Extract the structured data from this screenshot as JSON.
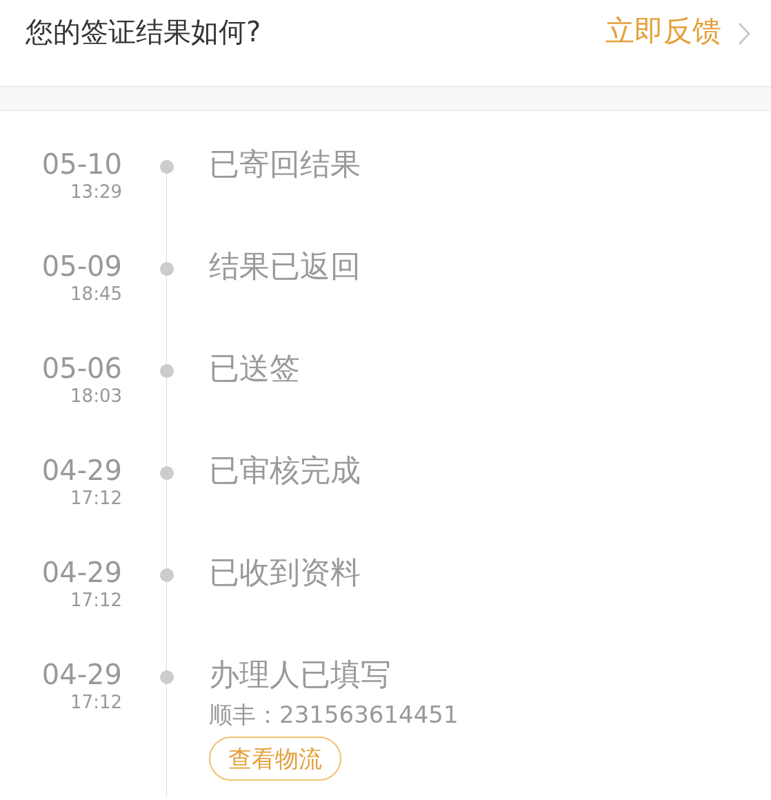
{
  "header": {
    "question": "您的签证结果如何?",
    "feedback_link": "立即反馈"
  },
  "timeline": [
    {
      "date": "05-10",
      "time": "13:29",
      "status": "已寄回结果"
    },
    {
      "date": "05-09",
      "time": "18:45",
      "status": "结果已返回"
    },
    {
      "date": "05-06",
      "time": "18:03",
      "status": "已送签"
    },
    {
      "date": "04-29",
      "time": "17:12",
      "status": "已审核完成"
    },
    {
      "date": "04-29",
      "time": "17:12",
      "status": "已收到资料"
    },
    {
      "date": "04-29",
      "time": "17:12",
      "status": "办理人已填写",
      "tracking": "顺丰：231563614451",
      "action": "查看物流"
    }
  ]
}
